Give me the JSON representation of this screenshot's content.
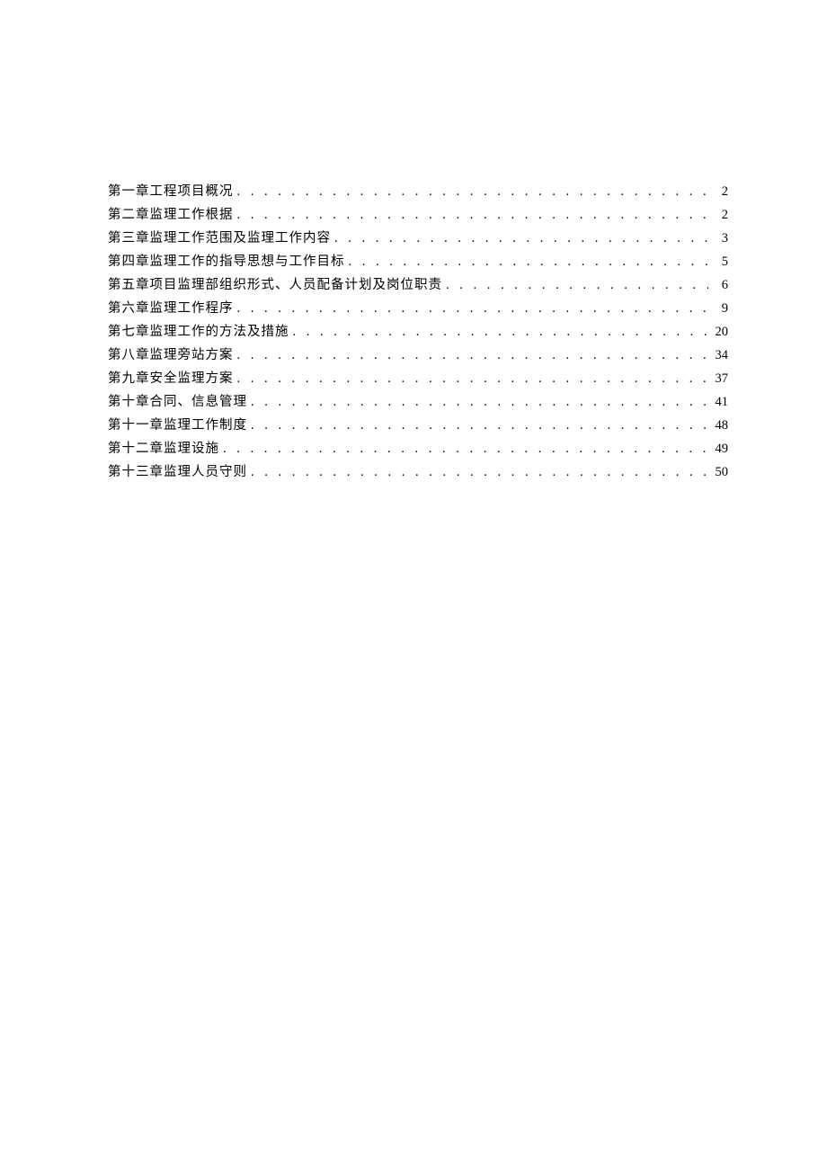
{
  "toc": [
    {
      "title": "第一章工程项目概况",
      "page": "2"
    },
    {
      "title": "第二章监理工作根据",
      "page": "2"
    },
    {
      "title": "第三章监理工作范围及监理工作内容",
      "page": "3"
    },
    {
      "title": "第四章监理工作的指导思想与工作目标",
      "page": "5"
    },
    {
      "title": "第五章项目监理部组织形式、人员配备计划及岗位职责",
      "page": "6"
    },
    {
      "title": "第六章监理工作程序",
      "page": "9"
    },
    {
      "title": "第七章监理工作的方法及措施",
      "page": "20"
    },
    {
      "title": "第八章监理旁站方案",
      "page": "34"
    },
    {
      "title": "第九章安全监理方案",
      "page": "37"
    },
    {
      "title": "第十章合同、信息管理",
      "page": "41"
    },
    {
      "title": "第十一章监理工作制度",
      "page": "48"
    },
    {
      "title": "第十二章监理设施",
      "page": "49"
    },
    {
      "title": "第十三章监理人员守则",
      "page": "50"
    }
  ]
}
